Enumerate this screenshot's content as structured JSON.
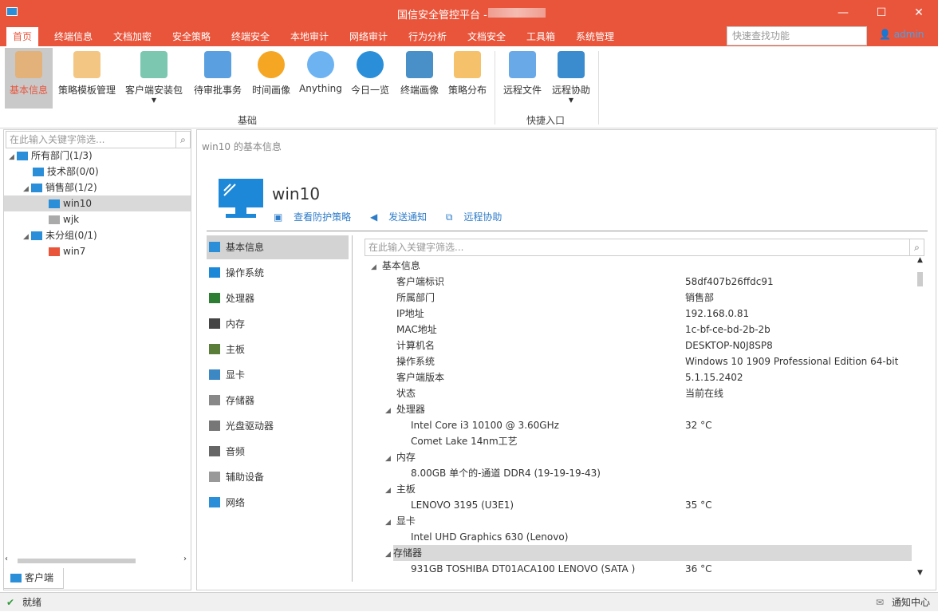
{
  "window": {
    "title": "国信安全管控平台 -",
    "minimize_icon": "minimize-icon",
    "maximize_icon": "maximize-icon",
    "close_icon": "close-icon"
  },
  "menu": [
    "首页",
    "终端信息",
    "文档加密",
    "安全策略",
    "终端安全",
    "本地审计",
    "网络审计",
    "行为分析",
    "文档安全",
    "工具箱",
    "系统管理"
  ],
  "top_search": {
    "placeholder": "快速查找功能"
  },
  "user": {
    "name": "admin"
  },
  "ribbon": {
    "buttons": [
      "基本信息",
      "策略模板管理",
      "客户端安装包",
      "待审批事务",
      "时间画像",
      "Anything",
      "今日一览",
      "终端画像",
      "策略分布",
      "远程文件",
      "远程协助"
    ],
    "groups": [
      "基础",
      "快捷入口"
    ]
  },
  "tree": {
    "search_placeholder": "在此输入关键字筛选...",
    "items": [
      "所有部门(1/3)",
      "技术部(0/0)",
      "销售部(1/2)",
      "win10",
      "wjk",
      "未分组(0/1)",
      "win7"
    ]
  },
  "bottom_tab": "客户端",
  "main": {
    "breadcrumb": "win10 的基本信息",
    "hostname": "win10",
    "links": [
      "查看防护策略",
      "发送通知",
      "远程协助"
    ],
    "categories": [
      "基本信息",
      "操作系统",
      "处理器",
      "内存",
      "主板",
      "显卡",
      "存储器",
      "光盘驱动器",
      "音频",
      "辅助设备",
      "网络"
    ],
    "detail_search_placeholder": "在此输入关键字筛选...",
    "details": [
      {
        "k": "基本信息",
        "v": ""
      },
      {
        "k": "客户端标识",
        "v": "58df407b26ffdc91"
      },
      {
        "k": "所属部门",
        "v": "销售部"
      },
      {
        "k": "IP地址",
        "v": "192.168.0.81"
      },
      {
        "k": "MAC地址",
        "v": "1c-bf-ce-bd-2b-2b"
      },
      {
        "k": "计算机名",
        "v": "DESKTOP-N0J8SP8"
      },
      {
        "k": "操作系统",
        "v": "Windows 10 1909 Professional Edition 64-bit"
      },
      {
        "k": "客户端版本",
        "v": "5.1.15.2402"
      },
      {
        "k": "状态",
        "v": "当前在线"
      },
      {
        "k": "处理器",
        "v": ""
      },
      {
        "k": "Intel Core i3 10100 @ 3.60GHz",
        "v": "32 °C"
      },
      {
        "k": "Comet Lake 14nm工艺",
        "v": ""
      },
      {
        "k": "内存",
        "v": ""
      },
      {
        "k": "8.00GB 单个的-通道 DDR4 (19-19-19-43)",
        "v": ""
      },
      {
        "k": "主板",
        "v": ""
      },
      {
        "k": "LENOVO 3195 (U3E1)",
        "v": "35 °C"
      },
      {
        "k": "显卡",
        "v": ""
      },
      {
        "k": "Intel UHD Graphics 630 (Lenovo)",
        "v": ""
      },
      {
        "k": "存储器",
        "v": ""
      },
      {
        "k": "931GB TOSHIBA DT01ACA100 LENOVO (SATA )",
        "v": "36 °C"
      }
    ]
  },
  "status": {
    "left": "就绪",
    "right": "通知中心"
  }
}
